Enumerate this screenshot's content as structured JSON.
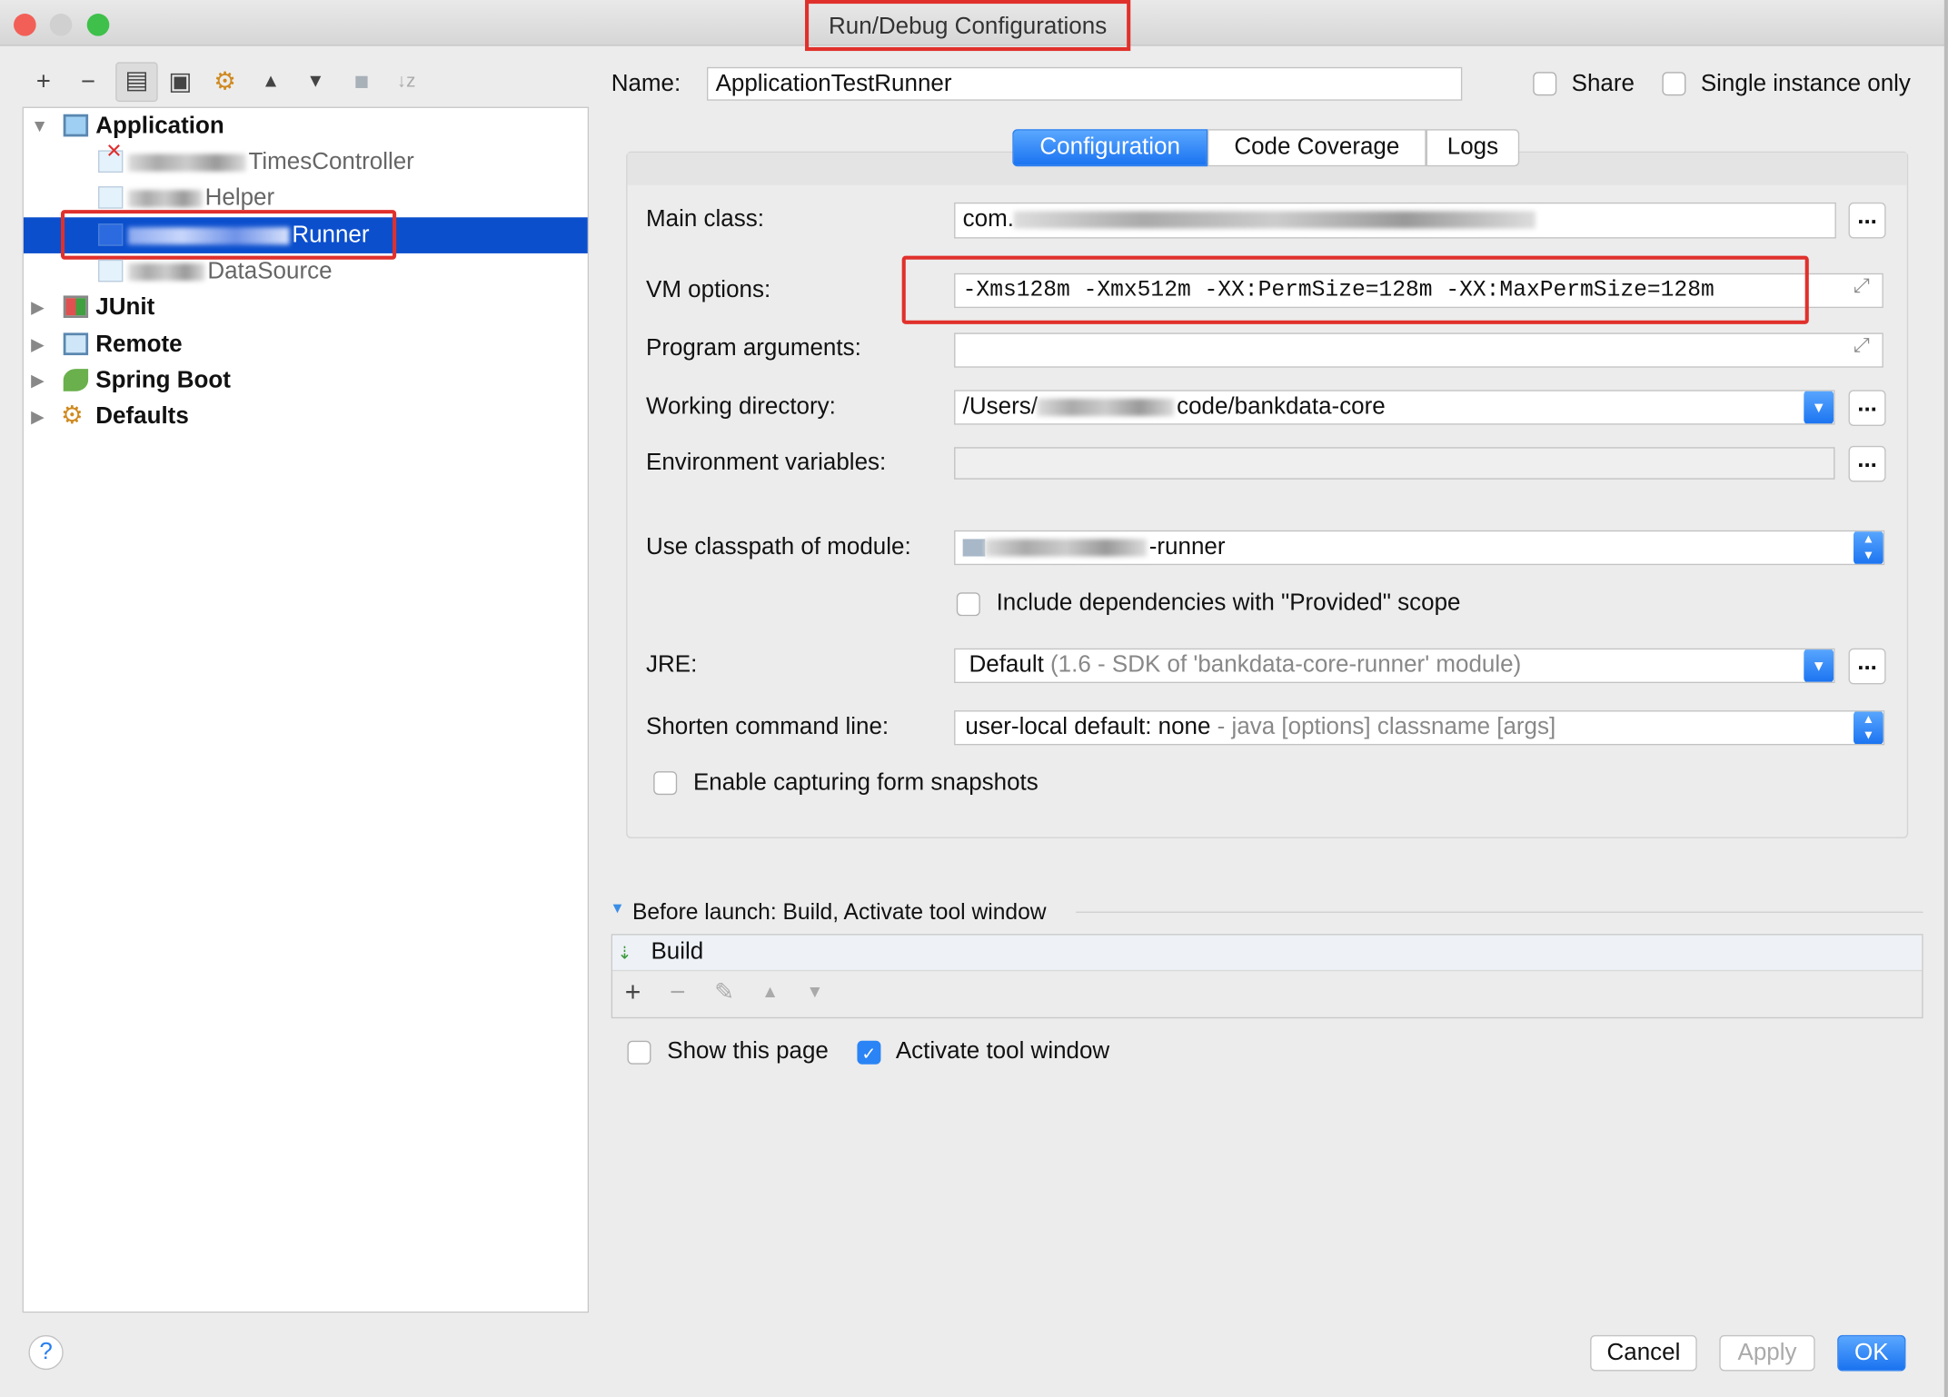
{
  "window": {
    "title": "Run/Debug Configurations"
  },
  "toolbar": {
    "icons": [
      "add-icon",
      "remove-icon",
      "copy-icon",
      "save-icon",
      "edit-defaults-icon",
      "move-up-icon",
      "move-down-icon",
      "folder-icon",
      "sort-icon"
    ]
  },
  "tree": {
    "application": {
      "label": "Application",
      "children": [
        {
          "label": "TimesController",
          "error": true
        },
        {
          "label": "Helper"
        },
        {
          "label": "Runner",
          "selected": true
        },
        {
          "label": "DataSource"
        }
      ]
    },
    "groups": [
      {
        "label": "JUnit"
      },
      {
        "label": "Remote"
      },
      {
        "label": "Spring Boot"
      },
      {
        "label": "Defaults"
      }
    ]
  },
  "name": {
    "label": "Name:",
    "value": "ApplicationTestRunner"
  },
  "share": {
    "label": "Share",
    "checked": false
  },
  "single_instance": {
    "label": "Single instance only",
    "checked": false
  },
  "tabs": [
    {
      "label": "Configuration",
      "active": true
    },
    {
      "label": "Code Coverage"
    },
    {
      "label": "Logs"
    }
  ],
  "form": {
    "main_class": {
      "label": "Main class:",
      "value": "com."
    },
    "vm_options": {
      "label": "VM options:",
      "value": "-Xms128m -Xmx512m -XX:PermSize=128m -XX:MaxPermSize=128m"
    },
    "program_arguments": {
      "label": "Program arguments:",
      "value": ""
    },
    "working_directory": {
      "label": "Working directory:",
      "prefix": "/Users/",
      "suffix": "code/bankdata-core"
    },
    "environment_variables": {
      "label": "Environment variables:",
      "value": ""
    },
    "classpath_module": {
      "label": "Use classpath of module:",
      "suffix": "-runner"
    },
    "include_provided": {
      "label": "Include dependencies with \"Provided\" scope",
      "checked": false
    },
    "jre": {
      "label": "JRE:",
      "value": "Default",
      "hint": "(1.6 - SDK of 'bankdata-core-runner' module)"
    },
    "shorten": {
      "label": "Shorten command line:",
      "value": "user-local default: none",
      "hint": " - java [options] classname [args]"
    },
    "capture_snapshots": {
      "label": "Enable capturing form snapshots",
      "checked": false
    },
    "more_button": "..."
  },
  "before_launch": {
    "header": "Before launch: Build, Activate tool window",
    "items": [
      "Build"
    ]
  },
  "show_page": {
    "label": "Show this page",
    "checked": false
  },
  "activate_tool": {
    "label": "Activate tool window",
    "checked": true
  },
  "footer": {
    "help": "?",
    "cancel": "Cancel",
    "apply": "Apply",
    "ok": "OK"
  },
  "colors": {
    "accent": "#1a73f0",
    "selection": "#0b4fcd",
    "highlight": "#e0302c"
  }
}
